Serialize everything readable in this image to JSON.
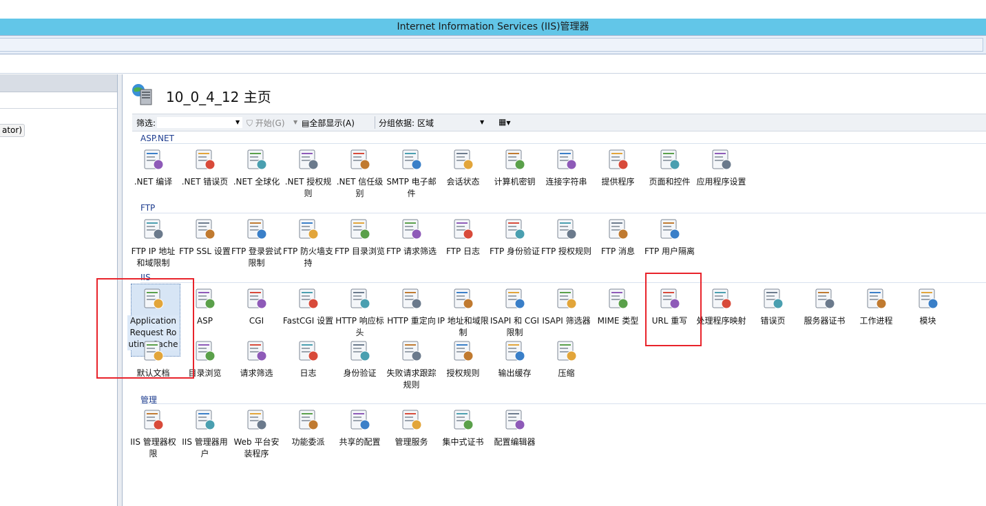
{
  "window": {
    "title": "Internet Information Services (IIS)管理器"
  },
  "left_pane": {
    "node_fragment": "ator)"
  },
  "main": {
    "title": "10_0_4_12 主页",
    "filterbar": {
      "filter_label": "筛选:",
      "filter_value": "",
      "go_label": "开始(G)",
      "show_all_label": "全部显示(A)",
      "group_by_label": "分组依据:",
      "group_by_value": "区域"
    },
    "groups": [
      {
        "title": "ASP.NET",
        "items": [
          {
            "label": ".NET 编译",
            "icon": "net-compile-icon"
          },
          {
            "label": ".NET 错误页",
            "icon": "net-error-pages-icon"
          },
          {
            "label": ".NET 全球化",
            "icon": "net-globalization-icon"
          },
          {
            "label": ".NET 授权规则",
            "icon": "net-authorization-icon"
          },
          {
            "label": ".NET 信任级别",
            "icon": "net-trust-levels-icon"
          },
          {
            "label": "SMTP 电子邮件",
            "icon": "smtp-email-icon"
          },
          {
            "label": "会话状态",
            "icon": "session-state-icon"
          },
          {
            "label": "计算机密钥",
            "icon": "machine-key-icon"
          },
          {
            "label": "连接字符串",
            "icon": "connection-strings-icon"
          },
          {
            "label": "提供程序",
            "icon": "providers-icon"
          },
          {
            "label": "页面和控件",
            "icon": "pages-controls-icon"
          },
          {
            "label": "应用程序设置",
            "icon": "app-settings-icon"
          }
        ]
      },
      {
        "title": "FTP",
        "items": [
          {
            "label": "FTP IP 地址和域限制",
            "icon": "ftp-ip-restrictions-icon"
          },
          {
            "label": "FTP SSL 设置",
            "icon": "ftp-ssl-icon"
          },
          {
            "label": "FTP 登录尝试限制",
            "icon": "ftp-logon-attempts-icon"
          },
          {
            "label": "FTP 防火墙支持",
            "icon": "ftp-firewall-icon"
          },
          {
            "label": "FTP 目录浏览",
            "icon": "ftp-directory-browsing-icon"
          },
          {
            "label": "FTP 请求筛选",
            "icon": "ftp-request-filtering-icon"
          },
          {
            "label": "FTP 日志",
            "icon": "ftp-logging-icon"
          },
          {
            "label": "FTP 身份验证",
            "icon": "ftp-authentication-icon"
          },
          {
            "label": "FTP 授权规则",
            "icon": "ftp-authorization-icon"
          },
          {
            "label": "FTP 消息",
            "icon": "ftp-messages-icon"
          },
          {
            "label": "FTP 用户隔离",
            "icon": "ftp-user-isolation-icon"
          }
        ]
      },
      {
        "title": "IIS",
        "items": [
          {
            "label": "Application Request Routing Cache",
            "icon": "arr-cache-icon",
            "selected": true
          },
          {
            "label": "ASP",
            "icon": "asp-icon"
          },
          {
            "label": "CGI",
            "icon": "cgi-icon"
          },
          {
            "label": "FastCGI 设置",
            "icon": "fastcgi-icon"
          },
          {
            "label": "HTTP 响应标头",
            "icon": "http-response-headers-icon"
          },
          {
            "label": "HTTP 重定向",
            "icon": "http-redirect-icon"
          },
          {
            "label": "IP 地址和域限制",
            "icon": "ip-restrictions-icon"
          },
          {
            "label": "ISAPI 和 CGI 限制",
            "icon": "isapi-cgi-restrictions-icon"
          },
          {
            "label": "ISAPI 筛选器",
            "icon": "isapi-filters-icon"
          },
          {
            "label": "MIME 类型",
            "icon": "mime-types-icon"
          },
          {
            "label": "URL 重写",
            "icon": "url-rewrite-icon"
          },
          {
            "label": "处理程序映射",
            "icon": "handler-mappings-icon"
          },
          {
            "label": "错误页",
            "icon": "error-pages-icon"
          },
          {
            "label": "服务器证书",
            "icon": "server-certificates-icon"
          },
          {
            "label": "工作进程",
            "icon": "worker-processes-icon"
          },
          {
            "label": "模块",
            "icon": "modules-icon"
          },
          {
            "label": "默认文档",
            "icon": "default-document-icon"
          },
          {
            "label": "目录浏览",
            "icon": "directory-browsing-icon"
          },
          {
            "label": "请求筛选",
            "icon": "request-filtering-icon"
          },
          {
            "label": "日志",
            "icon": "logging-icon"
          },
          {
            "label": "身份验证",
            "icon": "authentication-icon"
          },
          {
            "label": "失败请求跟踪规则",
            "icon": "failed-request-tracing-icon"
          },
          {
            "label": "授权规则",
            "icon": "authorization-rules-icon"
          },
          {
            "label": "输出缓存",
            "icon": "output-caching-icon"
          },
          {
            "label": "压缩",
            "icon": "compression-icon"
          }
        ]
      },
      {
        "title": "管理",
        "items": [
          {
            "label": "IIS 管理器权限",
            "icon": "iis-manager-permissions-icon"
          },
          {
            "label": "IIS 管理器用户",
            "icon": "iis-manager-users-icon"
          },
          {
            "label": "Web 平台安装程序",
            "icon": "web-platform-installer-icon"
          },
          {
            "label": "功能委派",
            "icon": "feature-delegation-icon"
          },
          {
            "label": "共享的配置",
            "icon": "shared-configuration-icon"
          },
          {
            "label": "管理服务",
            "icon": "management-service-icon"
          },
          {
            "label": "集中式证书",
            "icon": "centralized-certificates-icon"
          },
          {
            "label": "配置编辑器",
            "icon": "configuration-editor-icon"
          }
        ]
      }
    ]
  },
  "colors": {
    "titlebar": "#62c6e8",
    "highlight_box": "#e8222a",
    "group_title": "#1d3c8f"
  }
}
